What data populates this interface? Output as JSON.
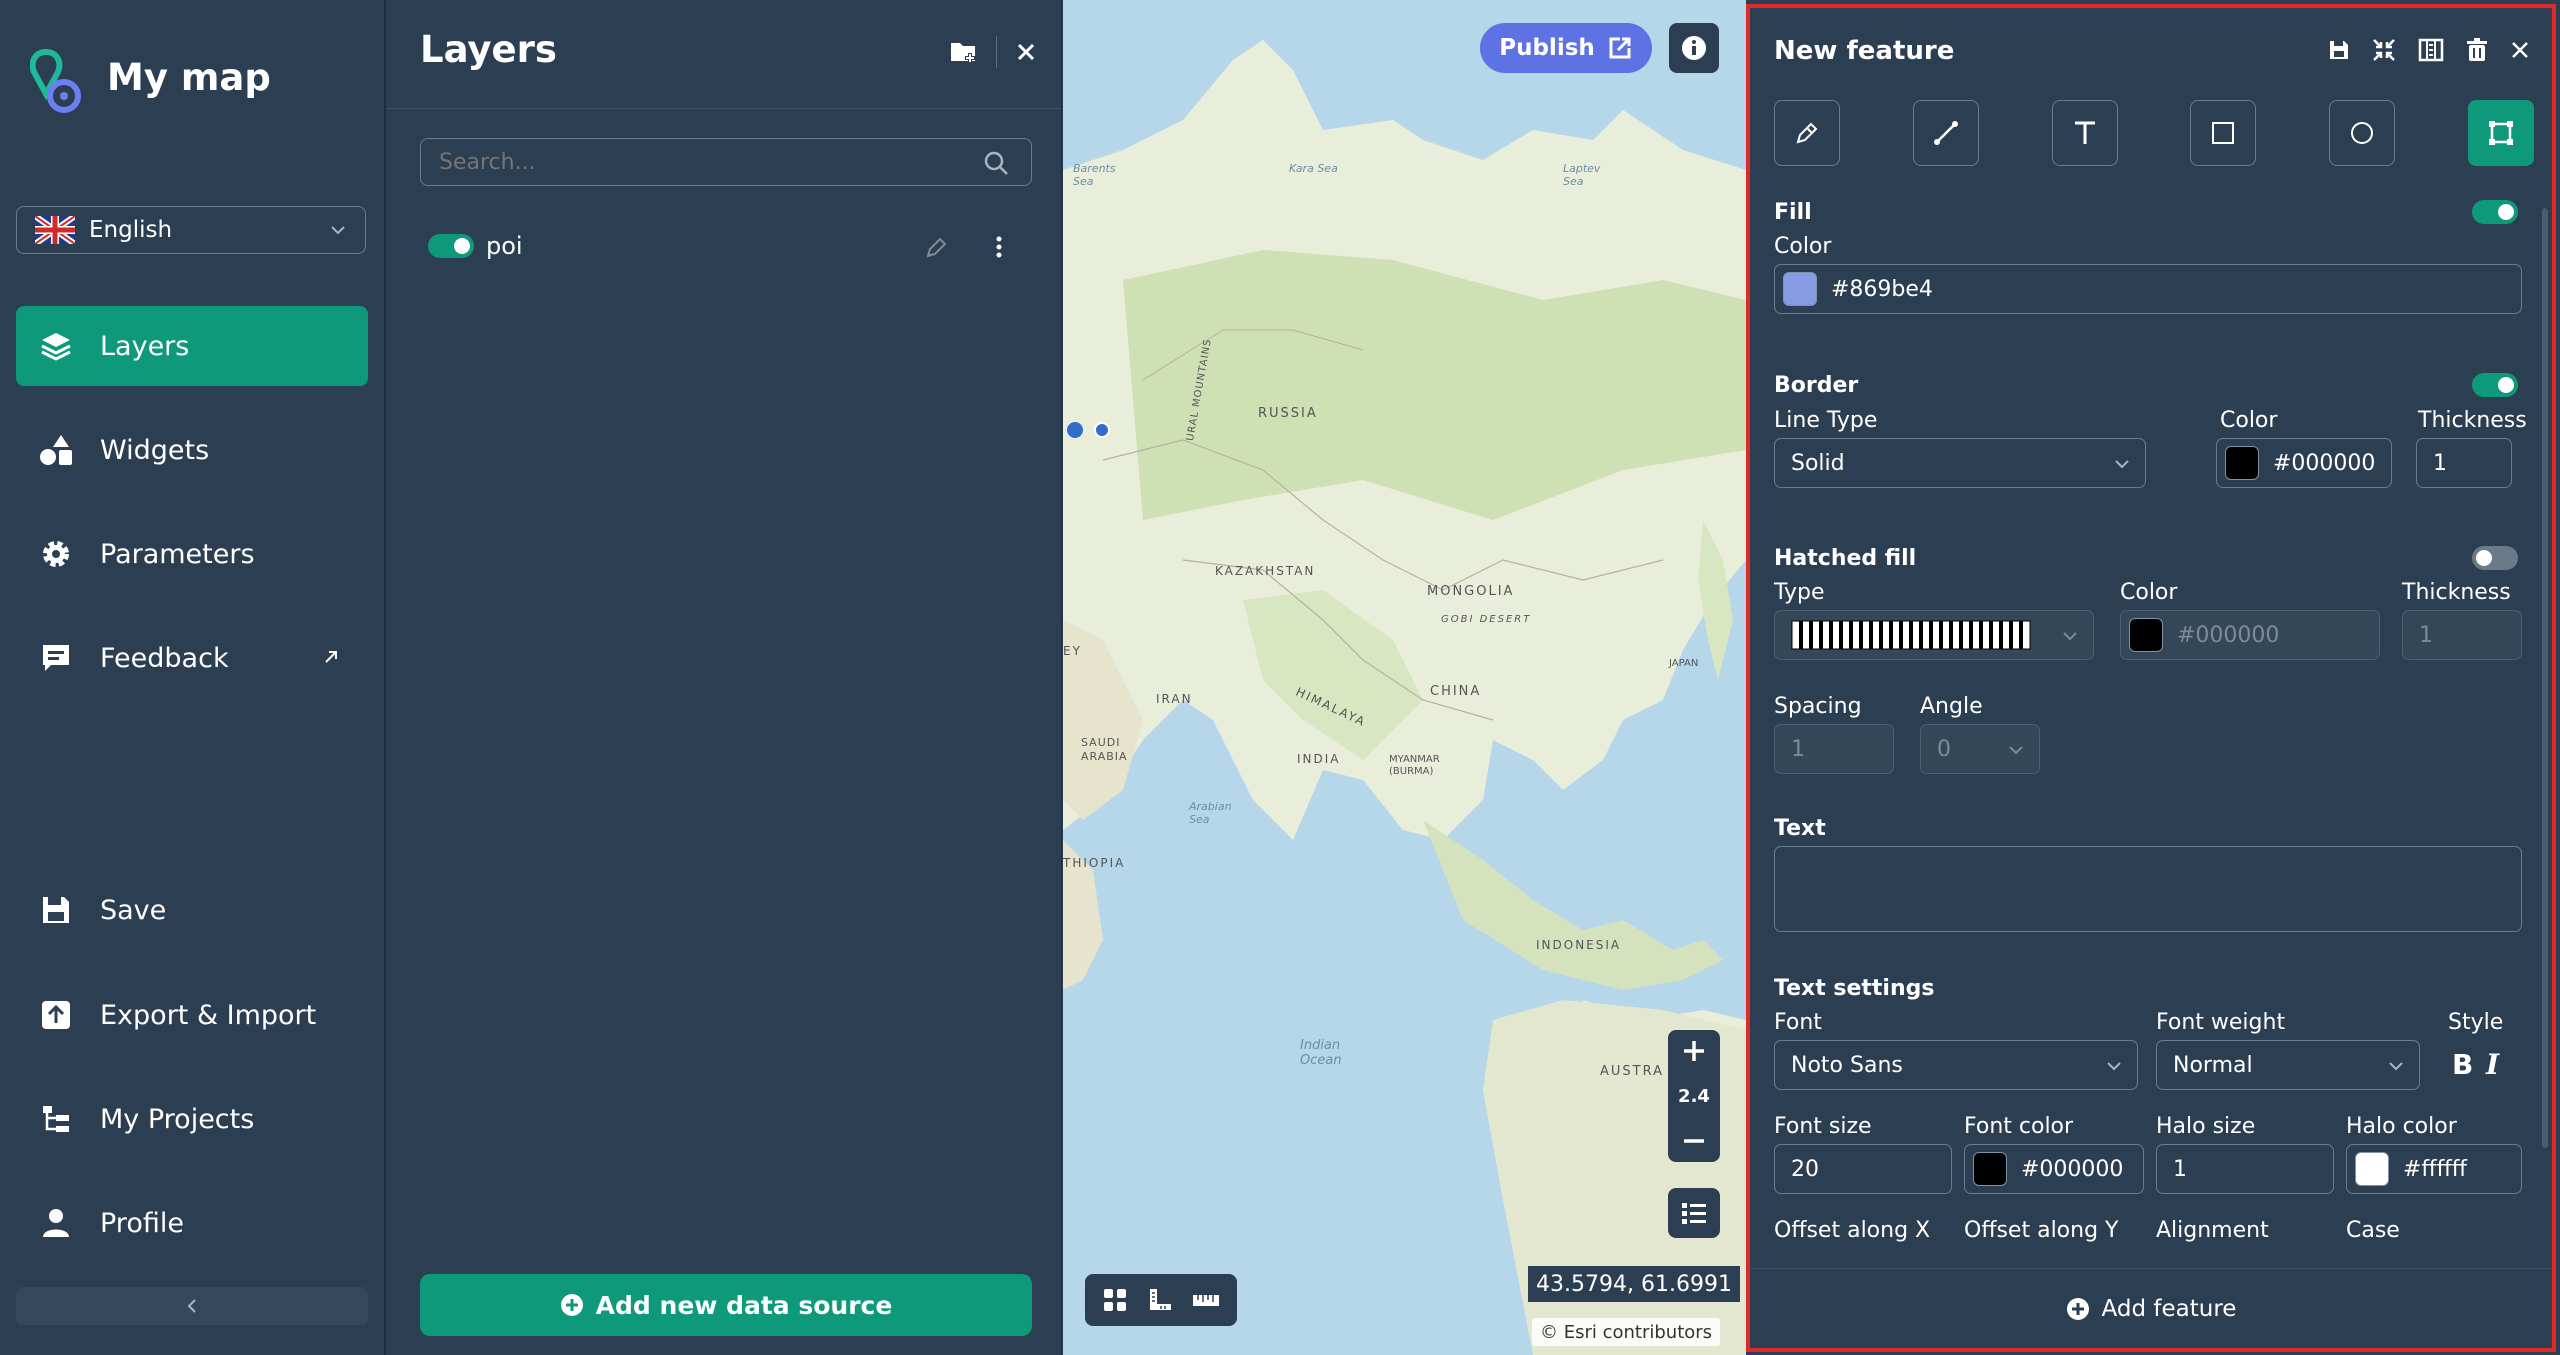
{
  "sidebar": {
    "app_title": "My map",
    "language": "English",
    "nav": [
      {
        "label": "Layers"
      },
      {
        "label": "Widgets"
      },
      {
        "label": "Parameters"
      },
      {
        "label": "Feedback"
      },
      {
        "label": "Save"
      },
      {
        "label": "Export & Import"
      },
      {
        "label": "My Projects"
      },
      {
        "label": "Profile"
      }
    ]
  },
  "layers_panel": {
    "title": "Layers",
    "search_placeholder": "Search...",
    "layers": [
      {
        "name": "poi",
        "enabled": true
      }
    ],
    "add_source_label": "Add new data source"
  },
  "map": {
    "publish_label": "Publish",
    "zoom_level": "2.4",
    "coords": "43.5794, 61.6991",
    "attribution": "© Esri contributors",
    "labels": {
      "russia": "RUSSIA",
      "kazakhstan": "KAZAKHSTAN",
      "mongolia": "MONGOLIA",
      "gobi": "GOBI DESERT",
      "china": "CHINA",
      "himalaya": "HIMALAYA",
      "iran": "IRAN",
      "saudi": "SAUDI ARABIA",
      "india": "INDIA",
      "myanmar": "MYANMAR (BURMA)",
      "indonesia": "INDONESIA",
      "japan": "JAPAN",
      "austra": "AUSTRA",
      "ural": "URAL MOUNTAINS",
      "ethiopia": "THIOPIA",
      "ey": "EY",
      "barents": "Barents Sea",
      "kara": "Kara Sea",
      "laptev": "Laptev Sea",
      "arabian": "Arabian Sea",
      "indian": "Indian Ocean"
    },
    "colors": {
      "water": "#b6d6ea",
      "land": "#e9eedb",
      "green": "#cfe0b4",
      "marker": "#2f6ec9"
    }
  },
  "feature_panel": {
    "title": "New feature",
    "fill": {
      "section": "Fill",
      "color_label": "Color",
      "color": "#869be4",
      "enabled": true
    },
    "border": {
      "section": "Border",
      "line_type_label": "Line Type",
      "line_type": "Solid",
      "color_label": "Color",
      "color": "#000000",
      "thickness_label": "Thickness",
      "thickness": "1",
      "enabled": true
    },
    "hatched": {
      "section": "Hatched fill",
      "type_label": "Type",
      "color_label": "Color",
      "color": "#000000",
      "thickness_label": "Thickness",
      "thickness": "1",
      "spacing_label": "Spacing",
      "spacing": "1",
      "angle_label": "Angle",
      "angle": "0",
      "enabled": false
    },
    "text": {
      "section": "Text"
    },
    "text_settings": {
      "section": "Text settings",
      "font_label": "Font",
      "font": "Noto Sans",
      "weight_label": "Font weight",
      "weight": "Normal",
      "style_label": "Style",
      "bold": "B",
      "italic": "I",
      "size_label": "Font size",
      "size": "20",
      "font_color_label": "Font color",
      "font_color": "#000000",
      "halo_size_label": "Halo size",
      "halo_size": "1",
      "halo_color_label": "Halo color",
      "halo_color": "#ffffff",
      "offset_x_label": "Offset along X",
      "offset_y_label": "Offset along Y",
      "alignment_label": "Alignment",
      "case_label": "Case"
    },
    "add_feature_label": "Add feature"
  },
  "theme": {
    "panel": "#2c3e52",
    "accent": "#0e9a7a",
    "publish": "#5e72e4",
    "highlight_border": "#e02a2a"
  }
}
